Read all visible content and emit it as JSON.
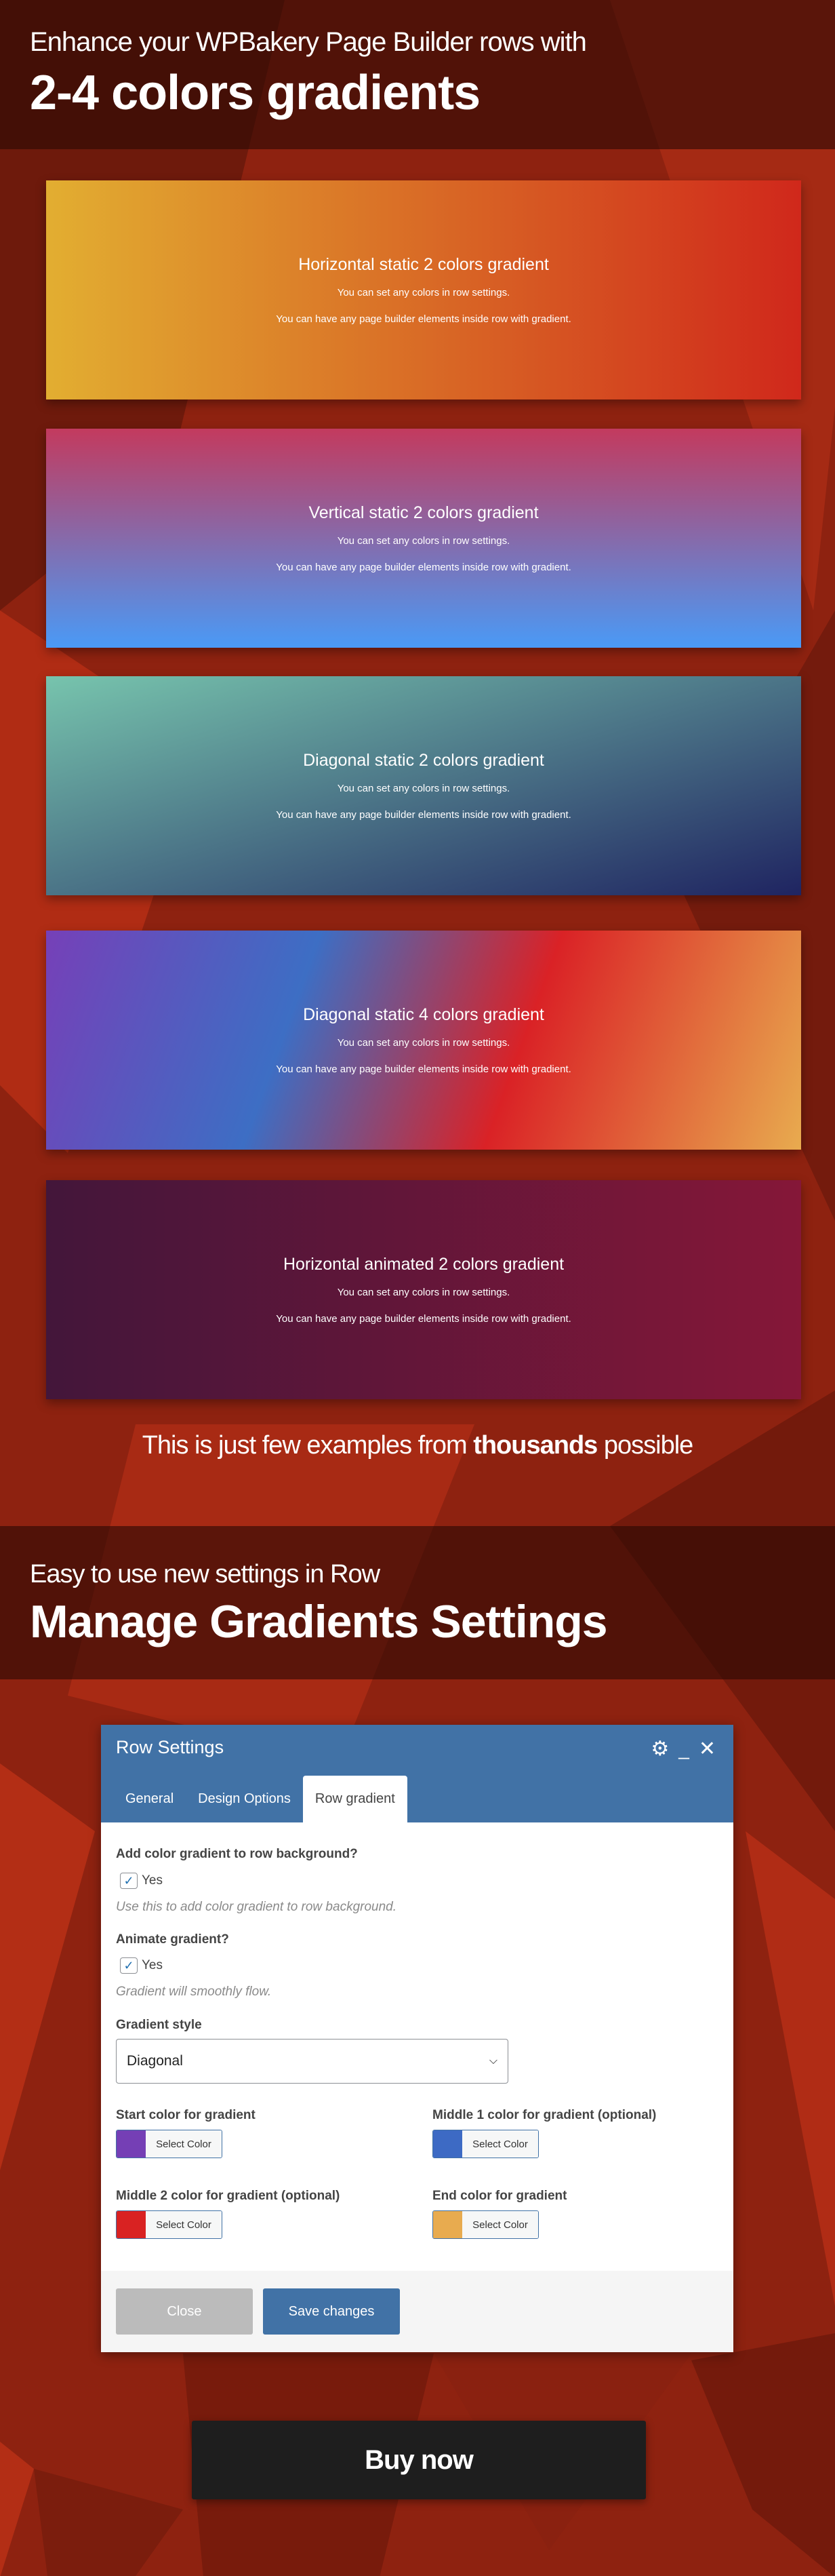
{
  "header": {
    "line1": "Enhance your WPBakery Page Builder rows with",
    "line2": "2-4 colors gradients"
  },
  "cards": [
    {
      "title": "Horizontal static 2 colors gradient",
      "text1": "You can set any colors in row settings.",
      "text2": "You can have any page builder elements inside row with gradient.",
      "colors": [
        "#e2ae31",
        "#d0281b"
      ]
    },
    {
      "title": "Vertical static 2 colors gradient",
      "text1": "You can set any colors in row settings.",
      "text2": "You can have any page builder elements inside row with gradient.",
      "colors": [
        "#c33a5e",
        "#4a9af6"
      ]
    },
    {
      "title": "Diagonal static 2 colors gradient",
      "text1": "You can set any colors in row settings.",
      "text2": "You can have any page builder elements inside row with gradient.",
      "colors": [
        "#77c4ad",
        "#1f2461"
      ]
    },
    {
      "title": "Diagonal static 4 colors gradient",
      "text1": "You can set any colors in row settings.",
      "text2": "You can have any page builder elements inside row with gradient.",
      "colors": [
        "#7640b8",
        "#3d6ec4",
        "#da2226",
        "#e8ab4f"
      ]
    },
    {
      "title": "Horizontal animated 2 colors gradient",
      "text1": "You can set any colors in row settings.",
      "text2": "You can have any page builder elements inside row with gradient.",
      "colors": [
        "#43163a",
        "#851738"
      ]
    }
  ],
  "examples": {
    "pre": "This is just few examples from ",
    "bold": "thousands",
    "post": " possible"
  },
  "section2": {
    "line1": "Easy to use new settings in Row",
    "line2": "Manage Gradients Settings"
  },
  "panel": {
    "title": "Row Settings",
    "icons": [
      "gear-icon",
      "minimize-icon",
      "close-icon"
    ],
    "tabs": [
      "General",
      "Design Options",
      "Row gradient"
    ],
    "active_tab": "Row gradient",
    "add_label": "Add color gradient to row background?",
    "add_check": "Yes",
    "add_help": "Use this to add color gradient to row background.",
    "anim_label": "Animate gradient?",
    "anim_check": "Yes",
    "anim_help": "Gradient will smoothly flow.",
    "style_label": "Gradient style",
    "style_value": "Diagonal",
    "colors": [
      {
        "label": "Start color for gradient",
        "button": "Select Color",
        "value": "#753fb5"
      },
      {
        "label": "Middle 1 color for gradient (optional)",
        "button": "Select Color",
        "value": "#3d6ac4"
      },
      {
        "label": "Middle 2 color for gradient (optional)",
        "button": "Select Color",
        "value": "#d92222"
      },
      {
        "label": "End color for gradient",
        "button": "Select Color",
        "value": "#e8ab4f"
      }
    ],
    "close": "Close",
    "save": "Save changes"
  },
  "buy": "Buy now"
}
